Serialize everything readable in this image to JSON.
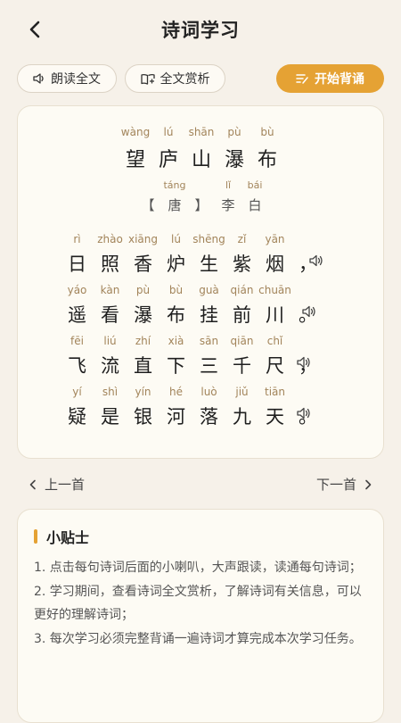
{
  "header": {
    "title": "诗词学习",
    "back_icon": "chevron-left-icon"
  },
  "toolbar": {
    "read_all_label": "朗读全文",
    "appreciate_label": "全文赏析",
    "recite_label": "开始背诵",
    "accent_color": "#e5a234"
  },
  "poem": {
    "title_pinyin": [
      "wàng",
      "lú",
      "shān",
      "pù",
      "bù"
    ],
    "title_chars": [
      "望",
      "庐",
      "山",
      "瀑",
      "布"
    ],
    "author_pinyin": [
      "",
      "táng",
      "",
      "lǐ",
      "bái"
    ],
    "author_chars": [
      "【",
      "唐",
      "】",
      "李",
      "白"
    ],
    "lines": [
      {
        "pinyin": [
          "rì",
          "zhào",
          "xiāng",
          "lú",
          "shēng",
          "zǐ",
          "yān",
          ""
        ],
        "chars": [
          "日",
          "照",
          "香",
          "炉",
          "生",
          "紫",
          "烟",
          "，"
        ]
      },
      {
        "pinyin": [
          "yáo",
          "kàn",
          "pù",
          "bù",
          "guà",
          "qián",
          "chuān",
          ""
        ],
        "chars": [
          "遥",
          "看",
          "瀑",
          "布",
          "挂",
          "前",
          "川",
          "。"
        ]
      },
      {
        "pinyin": [
          "fēi",
          "liú",
          "zhí",
          "xià",
          "sān",
          "qiān",
          "chǐ",
          ""
        ],
        "chars": [
          "飞",
          "流",
          "直",
          "下",
          "三",
          "千",
          "尺",
          "，"
        ]
      },
      {
        "pinyin": [
          "yí",
          "shì",
          "yín",
          "hé",
          "luò",
          "jiǔ",
          "tiān",
          ""
        ],
        "chars": [
          "疑",
          "是",
          "银",
          "河",
          "落",
          "九",
          "天",
          "。"
        ]
      }
    ],
    "speaker_icon": "speaker-icon"
  },
  "nav": {
    "prev_label": "上一首",
    "next_label": "下一首"
  },
  "tips": {
    "title": "小贴士",
    "items": [
      "1. 点击每句诗词后面的小喇叭，大声跟读，读通每句诗词；",
      "2. 学习期间，查看诗词全文赏析，了解诗词有关信息，可以更好的理解诗词；",
      "3. 每次学习必须完整背诵一遍诗词才算完成本次学习任务。"
    ]
  }
}
